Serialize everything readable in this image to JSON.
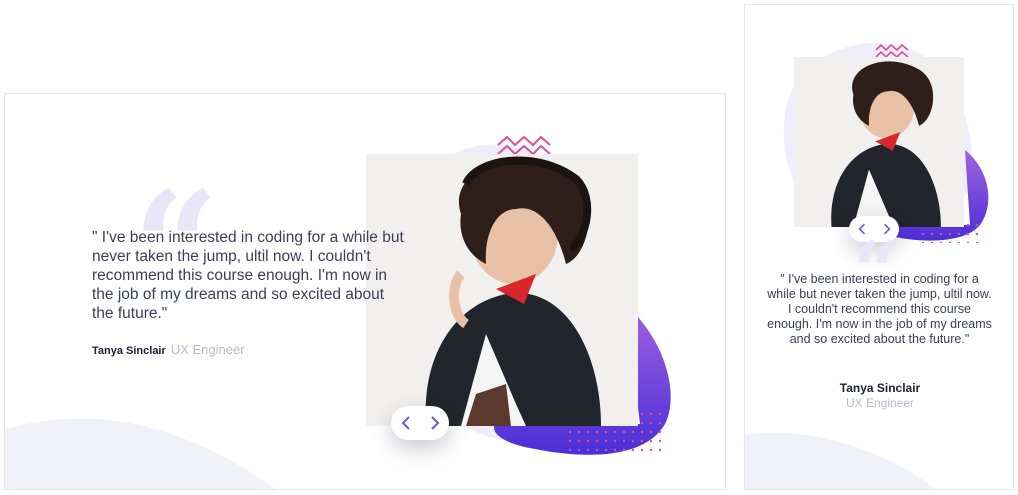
{
  "testimonial": {
    "quote": "\" I've been interested in coding for a while but never taken the jump, ultil now. I couldn't recommend this course enough. I'm now in the job of my dreams and so excited about the future.\"",
    "author_name": "Tanya Sinclair",
    "author_role": "UX Engineer"
  },
  "navigation": {
    "previous_icon": "chevron-left-icon",
    "next_icon": "chevron-right-icon"
  },
  "colors": {
    "accent_gradient_start": "#8a4cdd",
    "accent_gradient_end": "#4b2ed8",
    "blob_light": "#eeeefa",
    "pattern_pink": "#d7519a",
    "text_dark": "#3d3d57",
    "role_text": "#b9b8cf"
  }
}
